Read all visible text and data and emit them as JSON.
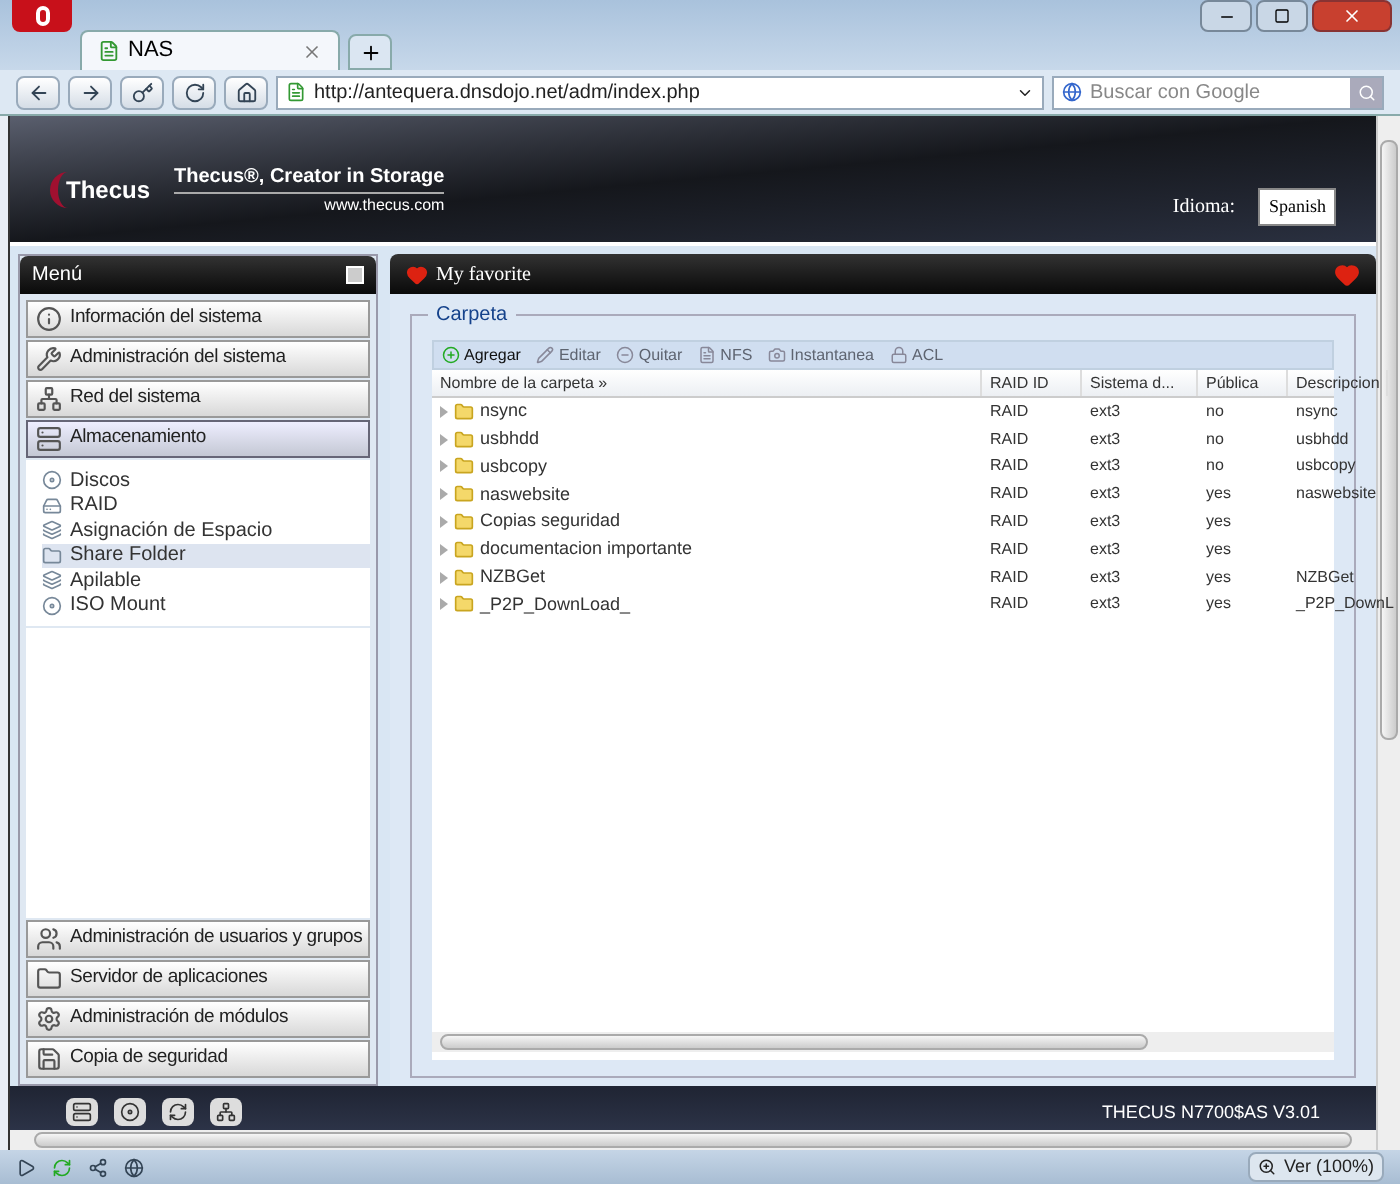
{
  "browser": {
    "tab": {
      "title": "NAS"
    },
    "url": "http://antequera.dnsdojo.net/adm/index.php",
    "search": {
      "placeholder": "Buscar con Google"
    }
  },
  "banner": {
    "logo": "Thecus",
    "tagline": "Thecus®, Creator in Storage",
    "website": "www.thecus.com",
    "language_label": "Idioma:",
    "language": "Spanish"
  },
  "menu": {
    "title": "Menú",
    "sections_top": [
      {
        "label": "Información del sistema",
        "expanded": false
      },
      {
        "label": "Administración del sistema",
        "expanded": false
      },
      {
        "label": "Red del sistema",
        "expanded": false
      },
      {
        "label": "Almacenamiento",
        "expanded": true,
        "children": [
          {
            "label": "Discos",
            "selected": false
          },
          {
            "label": "RAID",
            "selected": false
          },
          {
            "label": "Asignación de Espacio",
            "selected": false
          },
          {
            "label": "Share Folder",
            "selected": true
          },
          {
            "label": "Apilable",
            "selected": false
          },
          {
            "label": "ISO Mount",
            "selected": false
          }
        ]
      }
    ],
    "sections_bottom": [
      {
        "label": "Administración de usuarios y grupos"
      },
      {
        "label": "Servidor de aplicaciones"
      },
      {
        "label": "Administración de módulos"
      },
      {
        "label": "Copia de seguridad"
      }
    ]
  },
  "favorite": {
    "title": "My favorite"
  },
  "folder_panel": {
    "title": "Carpeta",
    "toolbar": [
      {
        "label": "Agregar",
        "disabled": false
      },
      {
        "label": "Editar",
        "disabled": true
      },
      {
        "label": "Quitar",
        "disabled": true
      },
      {
        "label": "NFS",
        "disabled": true
      },
      {
        "label": "Instantanea",
        "disabled": true
      },
      {
        "label": "ACL",
        "disabled": true
      }
    ],
    "columns": [
      "Nombre de la carpeta »",
      "RAID ID",
      "Sistema d...",
      "Pública",
      "Descripcion"
    ],
    "rows": [
      [
        "nsync",
        "RAID",
        "ext3",
        "no",
        "nsync"
      ],
      [
        "usbhdd",
        "RAID",
        "ext3",
        "no",
        "usbhdd"
      ],
      [
        "usbcopy",
        "RAID",
        "ext3",
        "no",
        "usbcopy"
      ],
      [
        "naswebsite",
        "RAID",
        "ext3",
        "yes",
        "naswebsite"
      ],
      [
        "Copias seguridad",
        "RAID",
        "ext3",
        "yes",
        ""
      ],
      [
        "documentacion importante",
        "RAID",
        "ext3",
        "yes",
        ""
      ],
      [
        "NZBGet",
        "RAID",
        "ext3",
        "yes",
        "NZBGet"
      ],
      [
        "_P2P_DownLoad_",
        "RAID",
        "ext3",
        "yes",
        "_P2P_DownL"
      ]
    ]
  },
  "footer": {
    "model": "THECUS N7700$AS V3.01"
  },
  "status_bar": {
    "zoom": "Ver (100%)"
  }
}
